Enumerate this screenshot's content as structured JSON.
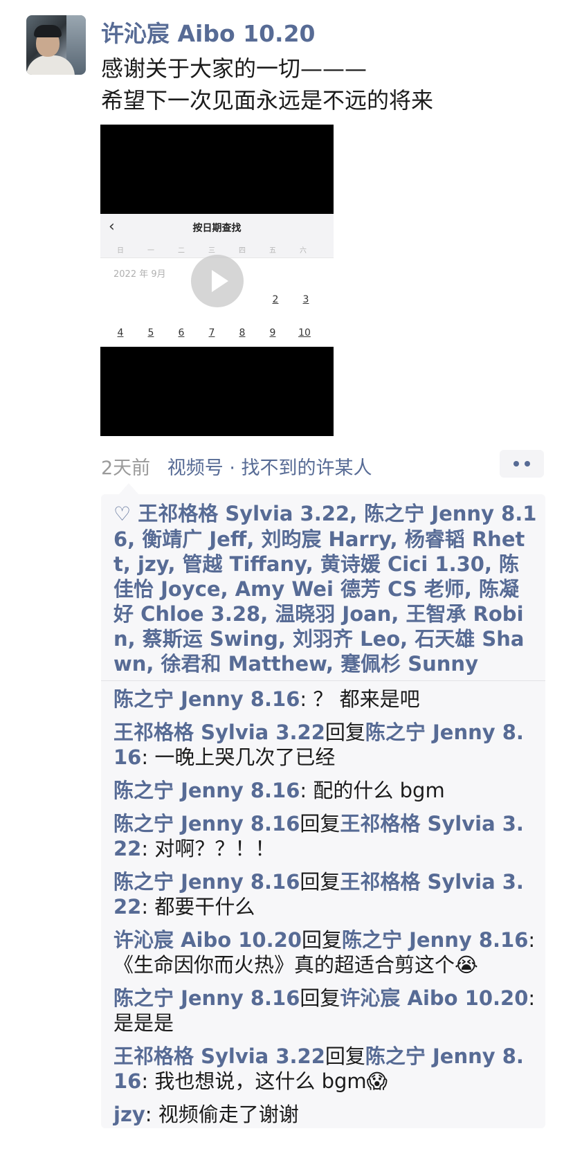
{
  "post": {
    "author": "许沁宸 Aibo 10.20",
    "text_line1": "感谢关于大家的一切———",
    "text_line2": "希望下一次见面永远是不远的将来",
    "time": "2天前",
    "channel": "视频号 · 找不到的许某人"
  },
  "video": {
    "screenshot_title": "按日期查找",
    "back_glyph": "‹",
    "weekdays": [
      "日",
      "一",
      "二",
      "三",
      "四",
      "五",
      "六"
    ],
    "month_label": "2022 年 9月",
    "days": [
      "2",
      "3",
      "4",
      "5",
      "6",
      "7",
      "8",
      "9",
      "10"
    ]
  },
  "likes": {
    "icon_glyph": "♡",
    "names": "王祁格格 Sylvia 3.22, 陈之宁 Jenny 8.16, 衡靖广 Jeff, 刘昀宸 Harry, 杨睿韬 Rhett, jzy, 管越 Tiffany, 黄诗媛 Cici 1.30, 陈佳怡 Joyce, Amy Wei 德芳 CS 老师, 陈凝好 Chloe 3.28, 温晓羽 Joan, 王智承 Robin, 蔡斯运 Swing, 刘羽齐 Leo, 石天雄 Shawn, 徐君和 Matthew, 蹇佩杉 Sunny"
  },
  "comments": [
    {
      "from": "陈之宁 Jenny 8.16",
      "reply": "",
      "to": "",
      "sep": ": ",
      "text": "？ 都来是吧"
    },
    {
      "from": "王祁格格 Sylvia 3.22",
      "reply": "回复",
      "to": "陈之宁 Jenny 8.16",
      "sep": ": ",
      "text": "一晚上哭几次了已经"
    },
    {
      "from": "陈之宁 Jenny 8.16",
      "reply": "",
      "to": "",
      "sep": ": ",
      "text": "配的什么 bgm"
    },
    {
      "from": "陈之宁 Jenny 8.16",
      "reply": "回复",
      "to": "王祁格格 Sylvia 3.22",
      "sep": ": ",
      "text": "对啊？？！！"
    },
    {
      "from": "陈之宁 Jenny 8.16",
      "reply": "回复",
      "to": "王祁格格 Sylvia 3.22",
      "sep": ": ",
      "text": "都要干什么"
    },
    {
      "from": "许沁宸 Aibo 10.20",
      "reply": "回复",
      "to": "陈之宁 Jenny 8.16",
      "sep": ": ",
      "text": "《生命因你而火热》真的超适合剪这个😭"
    },
    {
      "from": "陈之宁 Jenny 8.16",
      "reply": "回复",
      "to": "许沁宸 Aibo 10.20",
      "sep": ": ",
      "text": "是是是"
    },
    {
      "from": "王祁格格 Sylvia 3.22",
      "reply": "回复",
      "to": "陈之宁 Jenny 8.16",
      "sep": ": ",
      "text": "我也想说，这什么 bgm😱"
    },
    {
      "from": "jzy",
      "reply": "",
      "to": "",
      "sep": ": ",
      "text": "视频偷走了谢谢"
    }
  ]
}
